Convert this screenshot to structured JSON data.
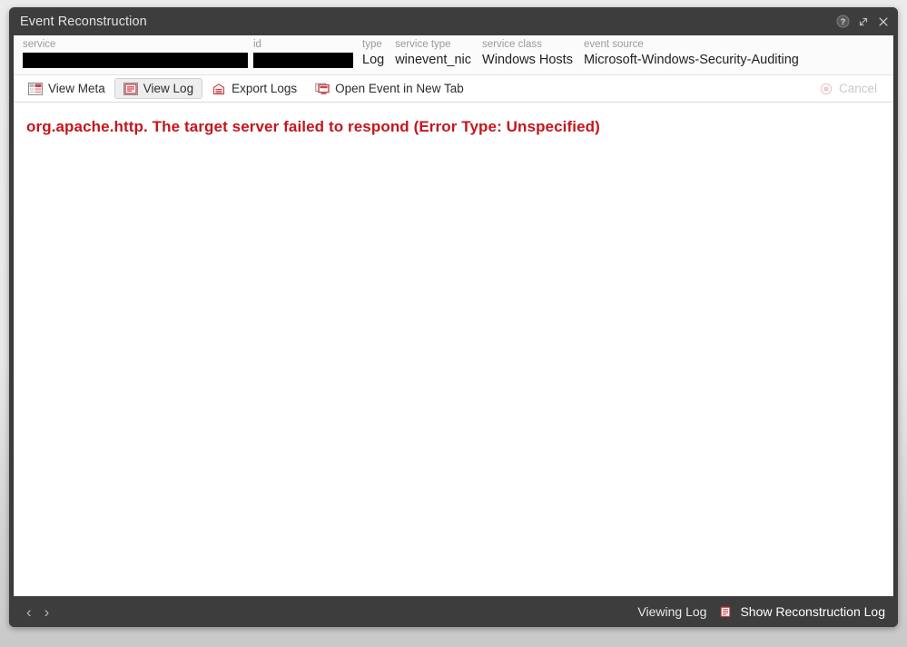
{
  "window": {
    "title": "Event Reconstruction",
    "title_actions": [
      {
        "name": "help-icon",
        "label": "Help"
      },
      {
        "name": "expand-icon",
        "label": "Expand"
      },
      {
        "name": "close-icon",
        "label": "Close"
      }
    ]
  },
  "meta": {
    "fields": [
      {
        "label": "service",
        "value": "",
        "redacted": true
      },
      {
        "label": "id",
        "value": "",
        "redacted": true
      },
      {
        "label": "type",
        "value": "Log",
        "redacted": false
      },
      {
        "label": "service type",
        "value": "winevent_nic",
        "redacted": false
      },
      {
        "label": "service class",
        "value": "Windows Hosts",
        "redacted": false
      },
      {
        "label": "event source",
        "value": "Microsoft-Windows-Security-Auditing",
        "redacted": false
      }
    ]
  },
  "toolbar": {
    "view_meta_label": "View Meta",
    "view_log_label": "View Log",
    "export_logs_label": "Export Logs",
    "open_event_label": "Open Event in New Tab",
    "cancel_label": "Cancel"
  },
  "log": {
    "error_text": "org.apache.http. The target server failed to respond (Error Type: Unspecified)"
  },
  "footer": {
    "prev_label": "‹",
    "next_label": "›",
    "viewing_status": "Viewing Log",
    "show_reconstruction_log_label": "Show Reconstruction Log"
  },
  "colors": {
    "chrome_dark": "#3d3d3d",
    "error_red": "#c4161c",
    "icon_red": "#c0392b",
    "accent_disabled": "#c9c9c9"
  }
}
